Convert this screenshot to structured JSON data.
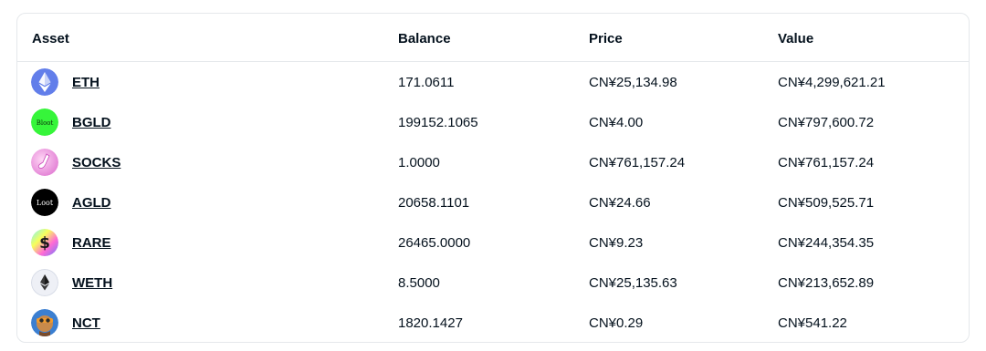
{
  "table": {
    "headers": {
      "asset": "Asset",
      "balance": "Balance",
      "price": "Price",
      "value": "Value"
    },
    "rows": [
      {
        "asset": "ETH",
        "icon": "eth-icon",
        "balance": "171.0611",
        "price": "CN¥25,134.98",
        "value": "CN¥4,299,621.21"
      },
      {
        "asset": "BGLD",
        "icon": "bloot-icon",
        "icon_text": "Bloot",
        "balance": "199152.1065",
        "price": "CN¥4.00",
        "value": "CN¥797,600.72"
      },
      {
        "asset": "SOCKS",
        "icon": "sock-icon",
        "balance": "1.0000",
        "price": "CN¥761,157.24",
        "value": "CN¥761,157.24"
      },
      {
        "asset": "AGLD",
        "icon": "loot-icon",
        "icon_text": "Loot",
        "balance": "20658.1101",
        "price": "CN¥24.66",
        "value": "CN¥509,525.71"
      },
      {
        "asset": "RARE",
        "icon": "rare-icon",
        "balance": "26465.0000",
        "price": "CN¥9.23",
        "value": "CN¥244,354.35"
      },
      {
        "asset": "WETH",
        "icon": "weth-icon",
        "balance": "8.5000",
        "price": "CN¥25,135.63",
        "value": "CN¥213,652.89"
      },
      {
        "asset": "NCT",
        "icon": "nct-icon",
        "balance": "1820.1427",
        "price": "CN¥0.29",
        "value": "CN¥541.22"
      }
    ]
  }
}
